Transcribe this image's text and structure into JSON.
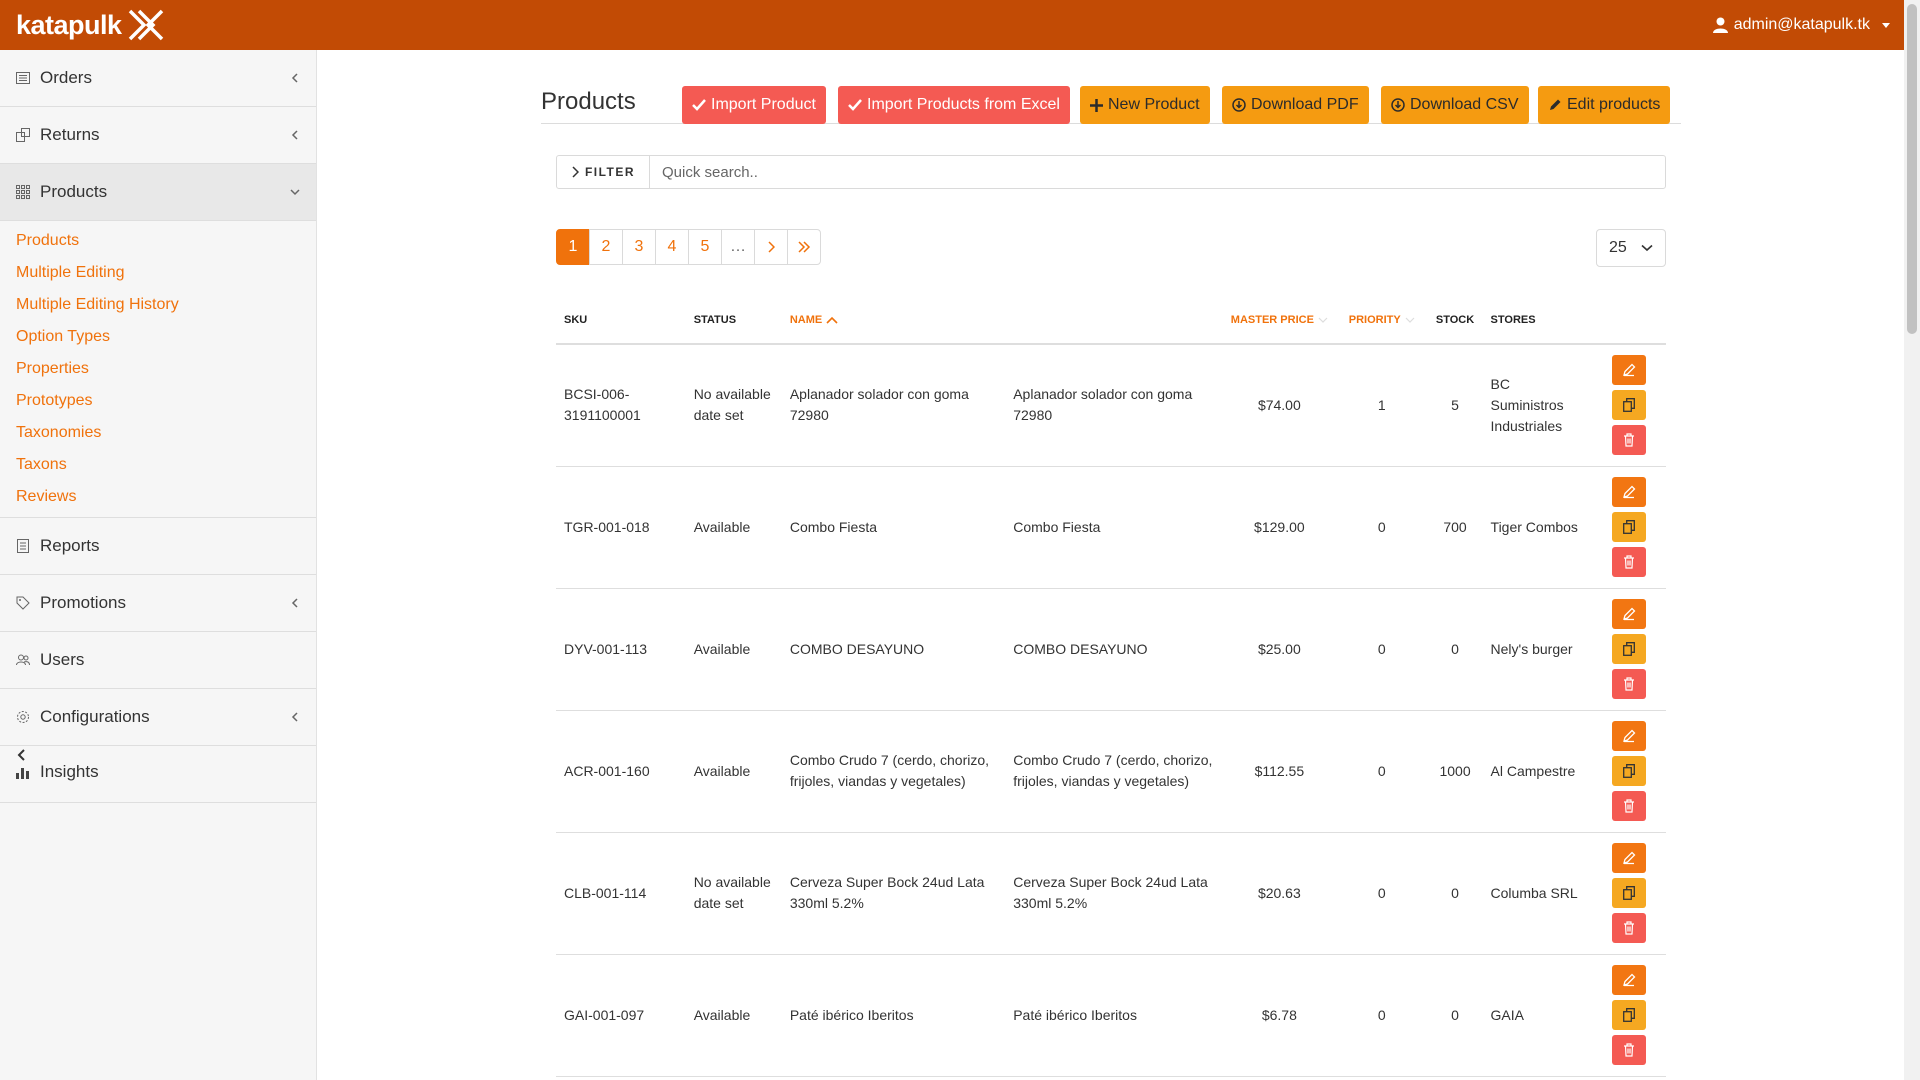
{
  "brand": {
    "name": "katapulk"
  },
  "user": {
    "email": "admin@katapulk.tk"
  },
  "sidebar": {
    "items": [
      {
        "label": "Orders"
      },
      {
        "label": "Returns"
      },
      {
        "label": "Products"
      },
      {
        "label": "Reports"
      },
      {
        "label": "Promotions"
      },
      {
        "label": "Users"
      },
      {
        "label": "Configurations"
      },
      {
        "label": "Insights"
      }
    ],
    "subitems": [
      "Products",
      "Multiple Editing",
      "Multiple Editing History",
      "Option Types",
      "Properties",
      "Prototypes",
      "Taxonomies",
      "Taxons",
      "Reviews"
    ]
  },
  "page": {
    "title": "Products",
    "buttons": {
      "import_product": "Import Product",
      "import_excel": "Import Products from Excel",
      "new_product": "New Product",
      "download_pdf": "Download PDF",
      "download_csv": "Download CSV",
      "edit_products": "Edit products"
    }
  },
  "filter": {
    "label": "FILTER",
    "placeholder": "Quick search.."
  },
  "pagination": {
    "pages": [
      "1",
      "2",
      "3",
      "4",
      "5",
      "…"
    ],
    "current": "1"
  },
  "per_page": "25",
  "table": {
    "headers": {
      "sku": "SKU",
      "status": "STATUS",
      "name": "NAME",
      "master_price": "MASTER PRICE",
      "priority": "PRIORITY",
      "stock": "STOCK",
      "stores": "STORES"
    },
    "rows": [
      {
        "sku": "BCSI-006-3191100001",
        "status": "No available date set",
        "image_alt": "Aplanador solador con goma 72980",
        "name": "Aplanador solador con goma 72980",
        "price": "$74.00",
        "priority": "1",
        "stock": "5",
        "stores": "BC Suministros Industriales"
      },
      {
        "sku": "TGR-001-018",
        "status": "Available",
        "image_alt": "Combo Fiesta",
        "name": "Combo Fiesta",
        "price": "$129.00",
        "priority": "0",
        "stock": "700",
        "stores": "Tiger Combos"
      },
      {
        "sku": "DYV-001-113",
        "status": "Available",
        "image_alt": "COMBO DESAYUNO",
        "name": "COMBO DESAYUNO",
        "price": "$25.00",
        "priority": "0",
        "stock": "0",
        "stores": "Nely's burger"
      },
      {
        "sku": "ACR-001-160",
        "status": "Available",
        "image_alt": "Combo Crudo 7 (cerdo, chorizo, frijoles, viandas y vegetales)",
        "name": "Combo Crudo 7 (cerdo, chorizo, frijoles, viandas y vegetales)",
        "price": "$112.55",
        "priority": "0",
        "stock": "1000",
        "stores": "Al Campestre"
      },
      {
        "sku": "CLB-001-114",
        "status": "No available date set",
        "image_alt": "Cerveza Super Bock 24ud Lata 330ml 5.2%",
        "name": "Cerveza Super Bock 24ud Lata 330ml 5.2%",
        "price": "$20.63",
        "priority": "0",
        "stock": "0",
        "stores": "Columba SRL"
      },
      {
        "sku": "GAI-001-097",
        "status": "Available",
        "image_alt": "Paté ibérico Iberitos",
        "name": "Paté ibérico Iberitos",
        "price": "$6.78",
        "priority": "0",
        "stock": "0",
        "stores": "GAIA"
      }
    ]
  }
}
